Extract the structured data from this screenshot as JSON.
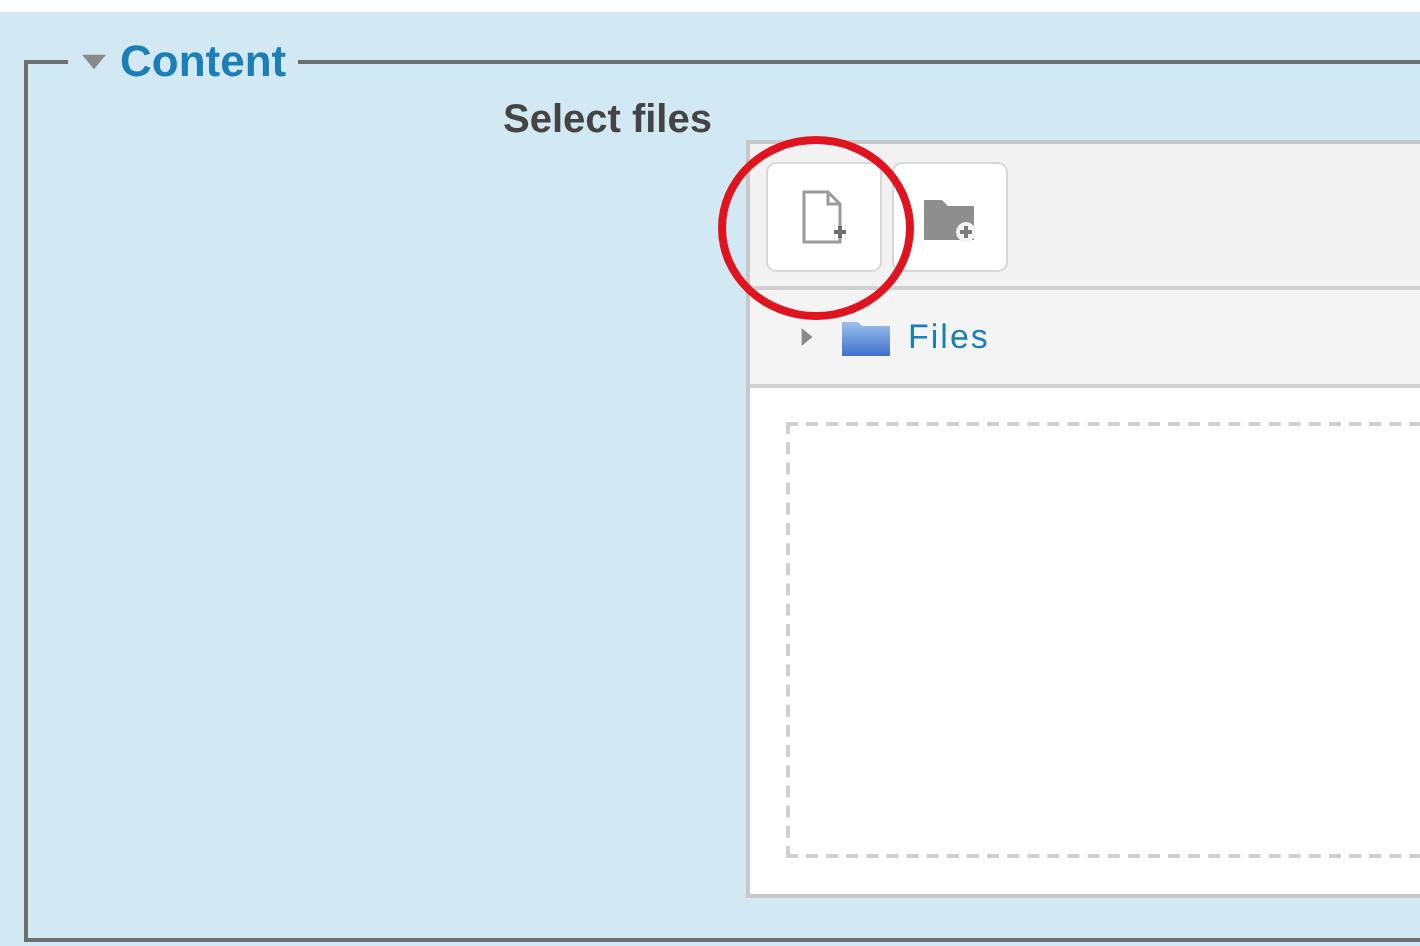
{
  "section": {
    "title": "Content",
    "expanded": true
  },
  "field": {
    "label": "Select files"
  },
  "file_picker": {
    "path": {
      "label": "Files",
      "expanded": false
    }
  }
}
